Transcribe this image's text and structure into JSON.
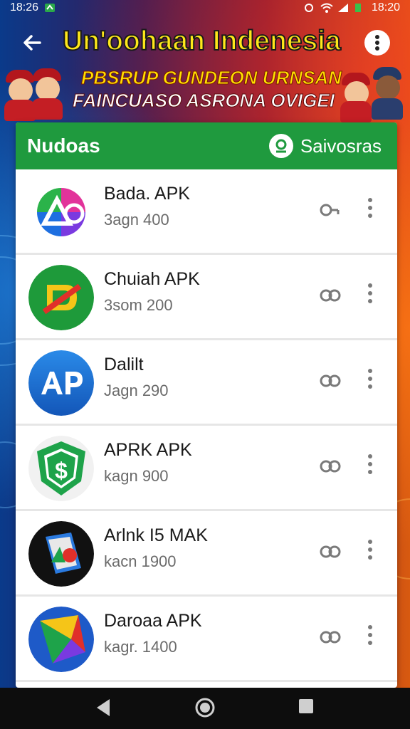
{
  "status": {
    "time_left": "18:26",
    "time_right": "18:20"
  },
  "header": {
    "title": "Un'oohaan Indenesia",
    "back_icon": "back-arrow-icon",
    "more_icon": "more-vert-icon"
  },
  "banner": {
    "line1": "PBSRUP GUNDEON URNSAN",
    "line2": "FAINCUASO ASRONA OVIGEI"
  },
  "card": {
    "title": "Nudoas",
    "action_label": "Saivosras",
    "action_icon": "download-icon",
    "header_color": "#1f9a3e"
  },
  "apps": [
    {
      "name": "Bada. APK",
      "sub": "3agn 400",
      "link_icon": "link-icon"
    },
    {
      "name": "Chuiah APK",
      "sub": "3som 200",
      "link_icon": "link-icon"
    },
    {
      "name": "Dalilt",
      "sub": "Jagn 290",
      "link_icon": "link-icon"
    },
    {
      "name": "APRK APK",
      "sub": "kagn 900",
      "link_icon": "link-icon"
    },
    {
      "name": "Arlnk I5 MAK",
      "sub": "kacn 1900",
      "link_icon": "link-icon"
    },
    {
      "name": "Daroaa APK",
      "sub": "kagr. 1400",
      "link_icon": "link-icon"
    }
  ],
  "navbar": {
    "back_icon": "nav-back-icon",
    "home_icon": "nav-home-icon",
    "recents_icon": "nav-recents-icon"
  }
}
